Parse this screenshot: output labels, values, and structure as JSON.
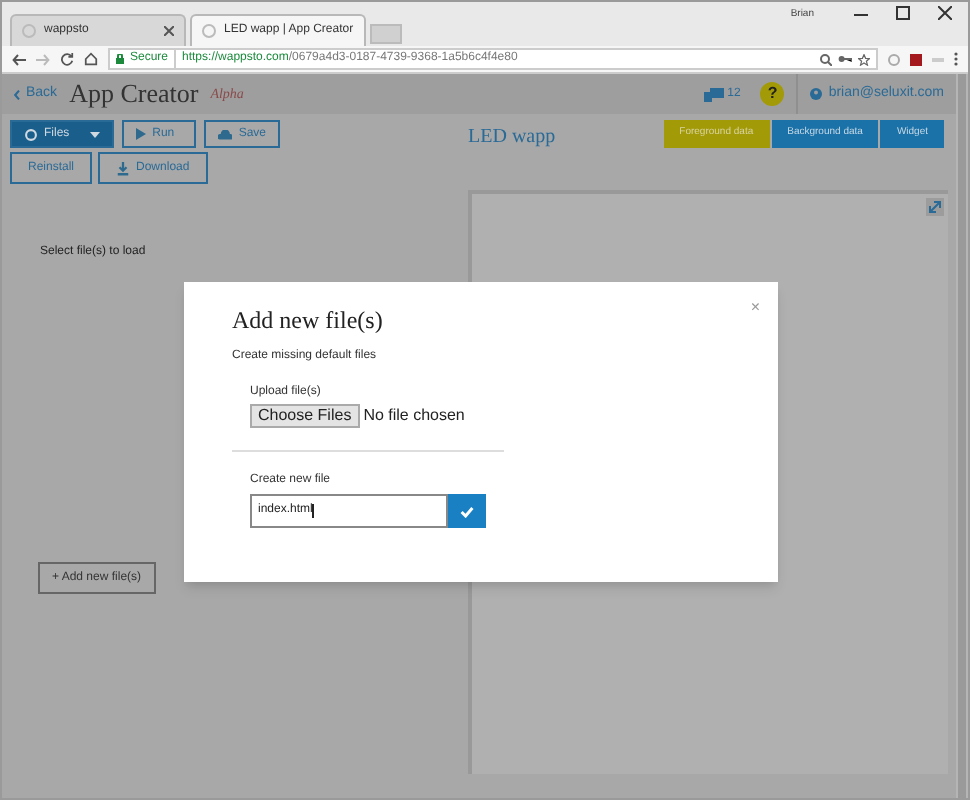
{
  "browser": {
    "tabs": [
      {
        "title": "wappsto",
        "selected": false
      },
      {
        "title": "LED wapp | App Creator",
        "selected": true
      }
    ],
    "user_badge": "Brian",
    "secure_label": "Secure",
    "url_host": "https://wappsto.com",
    "url_path": "/0679a4d3-0187-4739-9368-1a5b6c4f4e80"
  },
  "header": {
    "back": "Back",
    "title": "App Creator",
    "tag": "Alpha",
    "count": "12",
    "help": "?",
    "user": "brian@seluxit.com"
  },
  "toolbar": {
    "buttons": [
      {
        "label": "Files",
        "kind": "dropdown"
      },
      {
        "label": "Run",
        "kind": "play"
      },
      {
        "label": "Save",
        "kind": "cloud"
      }
    ],
    "second_row": [
      {
        "label": "Reinstall",
        "kind": "plain"
      },
      {
        "label": "Download",
        "kind": "download"
      }
    ],
    "app_name": "LED wapp",
    "tabs": [
      {
        "label": "Foreground data",
        "selected": true
      },
      {
        "label": "Background data",
        "selected": false
      },
      {
        "label": "Widget",
        "selected": false
      }
    ]
  },
  "left_panel": {
    "hint": "Select file(s) to load",
    "add_button": "+ Add new file(s)"
  },
  "dialog": {
    "title": "Add new file(s)",
    "subtitle": "Create missing default files",
    "upload_label": "Upload file(s)",
    "choose_button": "Choose Files",
    "no_file": "No file chosen",
    "create_label": "Create new file",
    "file_name": "index.html",
    "close": "×"
  }
}
